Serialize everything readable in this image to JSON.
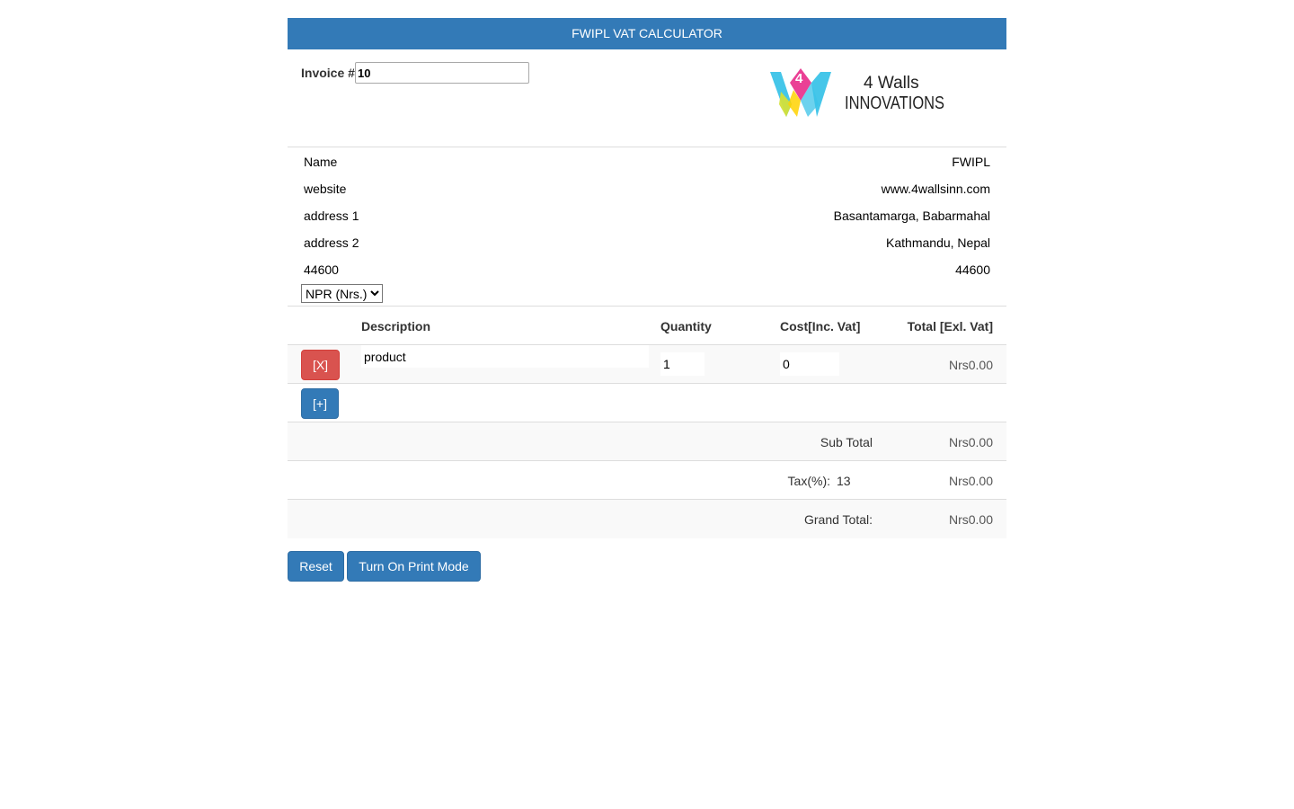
{
  "header": {
    "title": "FWIPL VAT CALCULATOR"
  },
  "invoice": {
    "label": "Invoice #",
    "value": "10"
  },
  "logo": {
    "badge": "4",
    "line1": "4 Walls",
    "line2": "INNOVATIONS",
    "colors": [
      "#3bc3e8",
      "#d4e03a",
      "#e9368f",
      "#ffd200"
    ]
  },
  "company_info": [
    {
      "label": "Name",
      "value": "FWIPL"
    },
    {
      "label": "website",
      "value": "www.4wallsinn.com"
    },
    {
      "label": "address 1",
      "value": "Basantamarga, Babarmahal"
    },
    {
      "label": "address 2",
      "value": "Kathmandu, Nepal"
    },
    {
      "label": "44600",
      "value": "44600"
    }
  ],
  "currency": {
    "selected": "NPR (Nrs.)"
  },
  "table": {
    "headers": {
      "description": "Description",
      "quantity": "Quantity",
      "cost": "Cost[Inc. Vat]",
      "total": "Total [Exl. Vat]"
    },
    "items": [
      {
        "remove_label": "[X]",
        "description": "product",
        "quantity": "1",
        "cost": "0",
        "total": "Nrs0.00"
      }
    ],
    "add_label": "[+]"
  },
  "summary": {
    "subtotal_label": "Sub Total",
    "subtotal_value": "Nrs0.00",
    "tax_label": "Tax(%):",
    "tax_rate": "13",
    "tax_value": "Nrs0.00",
    "grand_label": "Grand Total:",
    "grand_value": "Nrs0.00"
  },
  "actions": {
    "reset_label": "Reset",
    "print_label": "Turn On Print Mode"
  },
  "colors": {
    "primary": "#337ab7",
    "danger": "#d9534f"
  }
}
